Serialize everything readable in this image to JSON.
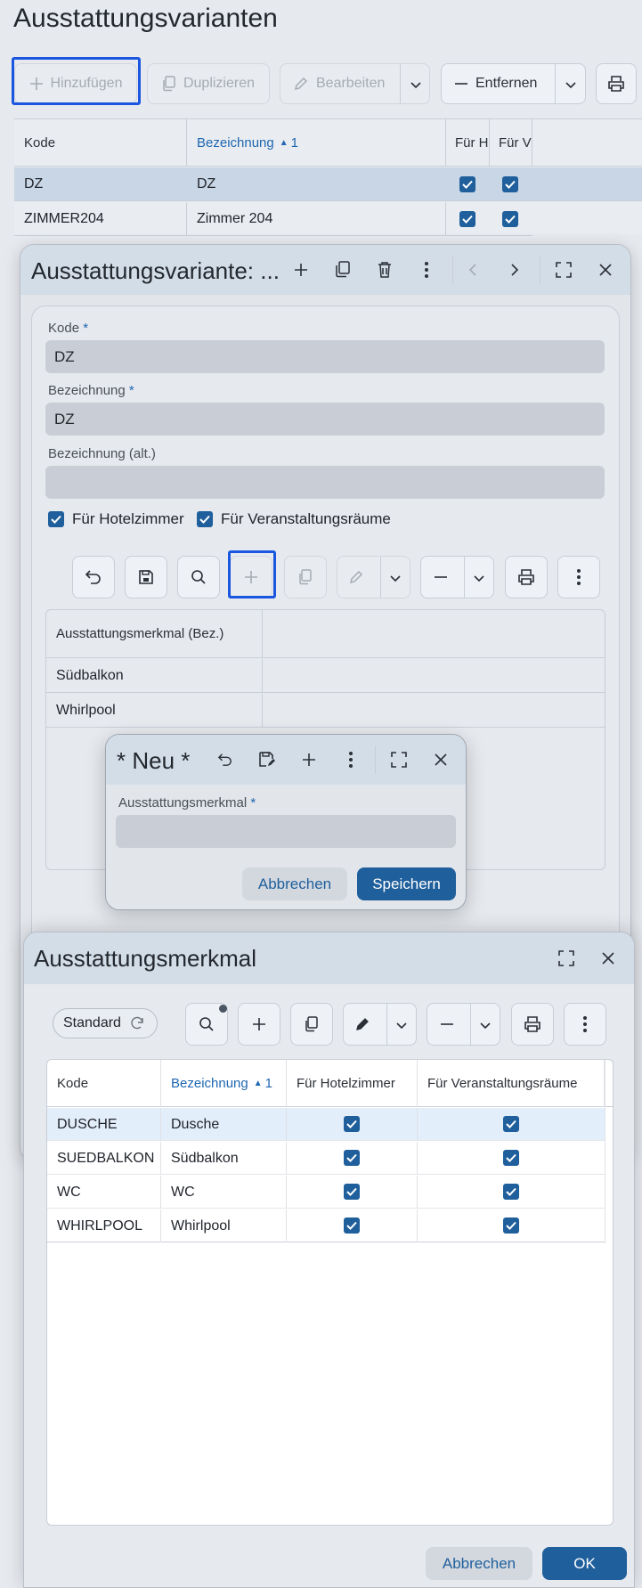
{
  "page": {
    "title": "Ausstattungsvarianten"
  },
  "main_toolbar": {
    "add": "Hinzufügen",
    "duplicate": "Duplizieren",
    "edit": "Bearbeiten",
    "remove": "Entfernen"
  },
  "main_table": {
    "headers": {
      "code": "Kode",
      "name": "Bezeichnung",
      "sort_index": "1",
      "hotel": "Für H",
      "event": "Für V"
    },
    "rows": [
      {
        "code": "DZ",
        "name": "DZ"
      },
      {
        "code": "ZIMMER204",
        "name": "Zimmer 204"
      }
    ]
  },
  "variant_dialog": {
    "title": "Ausstattungsvariante: ...",
    "fields": {
      "code_label": "Kode",
      "code_value": "DZ",
      "name_label": "Bezeichnung",
      "name_value": "DZ",
      "alt_label": "Bezeichnung (alt.)",
      "alt_value": "",
      "required_mark": "*"
    },
    "checkboxes": {
      "hotel": "Für Hotelzimmer",
      "event": "Für Veranstaltungsräume"
    },
    "subtable": {
      "header": "Ausstattungsmerkmal (Bez.)",
      "rows": [
        "Südbalkon",
        "Whirlpool"
      ]
    }
  },
  "new_dialog": {
    "title": "* Neu *",
    "field_label": "Ausstattungsmerkmal",
    "field_value": "",
    "required_mark": "*",
    "cancel": "Abbrechen",
    "save": "Speichern"
  },
  "feature_dialog": {
    "title": "Ausstattungsmerkmal",
    "view_chip": "Standard",
    "headers": {
      "code": "Kode",
      "name": "Bezeichnung",
      "sort_index": "1",
      "hotel": "Für Hotelzimmer",
      "event": "Für Veranstaltungsräume"
    },
    "rows": [
      {
        "code": "DUSCHE",
        "name": "Dusche"
      },
      {
        "code": "SUEDBALKON",
        "name": "Südbalkon"
      },
      {
        "code": "WC",
        "name": "WC"
      },
      {
        "code": "WHIRLPOOL",
        "name": "Whirlpool"
      }
    ],
    "cancel": "Abbrechen",
    "ok": "OK"
  },
  "colors": {
    "accent": "#1f5f9c",
    "focus": "#1a56e0",
    "selected_row": "#c9d6e6"
  }
}
